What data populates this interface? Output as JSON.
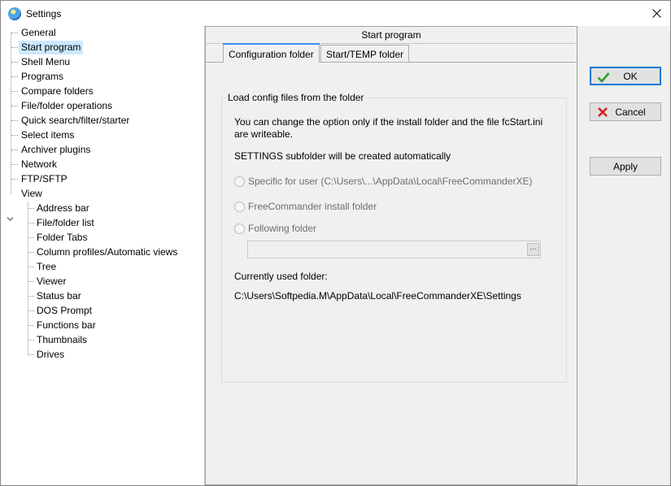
{
  "window": {
    "title": "Settings"
  },
  "tree": {
    "items": [
      {
        "label": "General"
      },
      {
        "label": "Start program"
      },
      {
        "label": "Shell Menu"
      },
      {
        "label": "Programs"
      },
      {
        "label": "Compare folders"
      },
      {
        "label": "File/folder operations"
      },
      {
        "label": "Quick search/filter/starter"
      },
      {
        "label": "Select items"
      },
      {
        "label": "Archiver plugins"
      },
      {
        "label": "Network"
      },
      {
        "label": "FTP/SFTP"
      },
      {
        "label": "View"
      }
    ],
    "view_children": [
      {
        "label": "Address bar"
      },
      {
        "label": "File/folder list"
      },
      {
        "label": "Folder Tabs"
      },
      {
        "label": "Column profiles/Automatic views"
      },
      {
        "label": "Tree"
      },
      {
        "label": "Viewer"
      },
      {
        "label": "Status bar"
      },
      {
        "label": "DOS Prompt"
      },
      {
        "label": "Functions bar"
      },
      {
        "label": "Thumbnails"
      },
      {
        "label": "Drives"
      }
    ],
    "selected": "Start program"
  },
  "page": {
    "header": "Start program",
    "tabs": [
      {
        "label": "Configuration folder",
        "active": true
      },
      {
        "label": "Start/TEMP folder",
        "active": false
      }
    ],
    "group": {
      "legend": "Load config files from the folder",
      "note_line1": "You can change the option only if the install folder and the file fcStart.ini",
      "note_line2": "are writeable.",
      "subfolder_note": "SETTINGS subfolder will be created automatically",
      "options": [
        {
          "label": "Specific for user (C:\\Users\\...\\AppData\\Local\\FreeCommanderXE)",
          "enabled": false
        },
        {
          "label": "FreeCommander install folder",
          "enabled": false
        },
        {
          "label": "Following folder",
          "enabled": false
        }
      ],
      "folder_value": "",
      "browse_label": "...",
      "current_label": "Currently used folder:",
      "current_path": "C:\\Users\\Softpedia.M\\AppData\\Local\\FreeCommanderXE\\Settings"
    }
  },
  "buttons": {
    "ok": "OK",
    "cancel": "Cancel",
    "apply": "Apply"
  },
  "colors": {
    "selection": "#cce8ff",
    "accent": "#0078d7",
    "ok_icon": "#2e9e2e",
    "cancel_icon": "#d81e1e"
  },
  "icons": {
    "app": "freecommander-icon",
    "close": "close-icon",
    "ok": "checkmark-icon",
    "cancel": "x-icon"
  }
}
